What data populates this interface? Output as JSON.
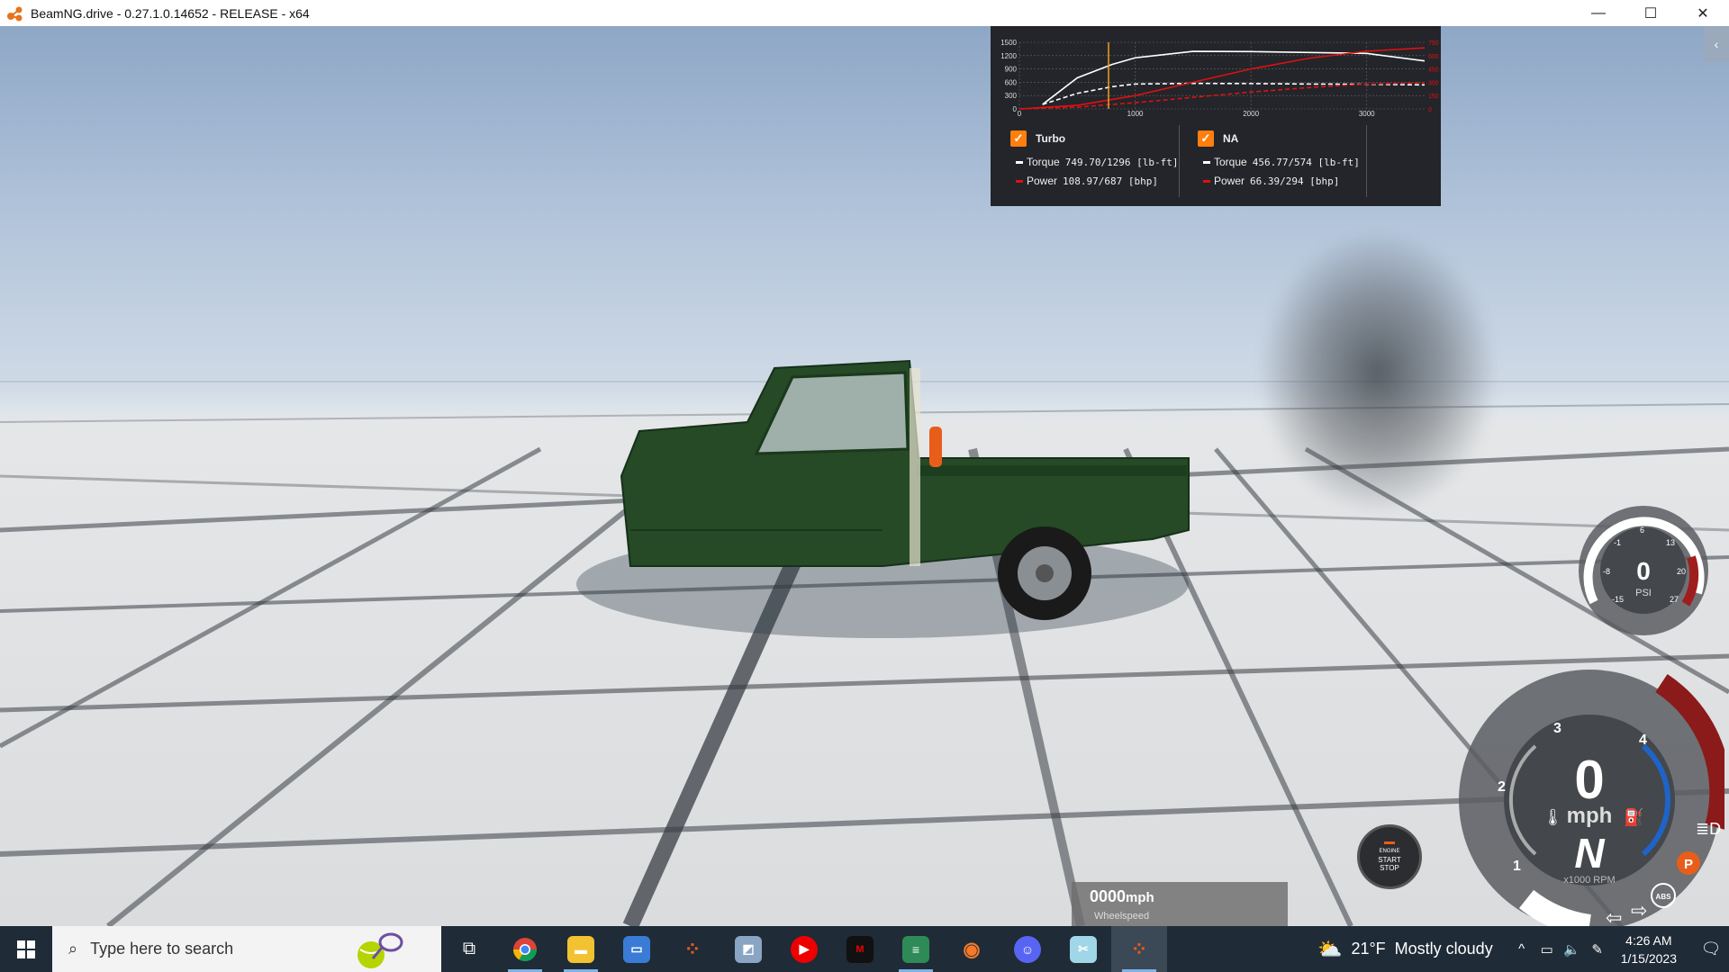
{
  "window": {
    "title": "BeamNG.drive - 0.27.1.0.14652 - RELEASE - x64",
    "minimize": "—",
    "maximize": "☐",
    "close": "✕"
  },
  "power_graph": {
    "y_ticks_left": [
      "1500",
      "1200",
      "900",
      "600",
      "300",
      "0"
    ],
    "y_ticks_right": [
      "750",
      "600",
      "450",
      "300",
      "150",
      "0"
    ],
    "x_ticks": [
      "0",
      "1000",
      "2000",
      "3000"
    ],
    "turbo": {
      "name": "Turbo",
      "checked": true,
      "torque_label": "Torque",
      "torque_value": "749.70/1296 [lb-ft]",
      "power_label": "Power",
      "power_value": "108.97/687  [bhp]"
    },
    "na": {
      "name": "NA",
      "checked": true,
      "torque_label": "Torque",
      "torque_value": "456.77/574 [lb-ft]",
      "power_label": "Power",
      "power_value": "66.39/294  [bhp]"
    },
    "colors": {
      "torque": "#ffffff",
      "power": "#e01010",
      "cursor": "#f0a020",
      "checkbox": "#ff7f0e"
    }
  },
  "chart_data": {
    "type": "line",
    "x_range": [
      0,
      3500
    ],
    "y_left_range": [
      0,
      1500
    ],
    "y_right_range": [
      0,
      750
    ],
    "series": [
      {
        "name": "Turbo Torque",
        "x": [
          200,
          500,
          800,
          1000,
          1500,
          2000,
          2500,
          3000,
          3500
        ],
        "y": [
          100,
          700,
          1000,
          1150,
          1296,
          1290,
          1270,
          1250,
          1080
        ]
      },
      {
        "name": "NA Torque",
        "x": [
          200,
          500,
          800,
          1000,
          1500,
          2000,
          2500,
          3000,
          3500
        ],
        "y": [
          100,
          350,
          500,
          560,
          574,
          570,
          560,
          555,
          540
        ]
      },
      {
        "name": "Turbo Power",
        "x": [
          0,
          500,
          1000,
          1500,
          2000,
          2500,
          3000,
          3500
        ],
        "y": [
          0,
          40,
          150,
          300,
          450,
          570,
          650,
          687
        ]
      },
      {
        "name": "NA Power",
        "x": [
          0,
          500,
          1000,
          1500,
          2000,
          2500,
          3000,
          3500
        ],
        "y": [
          0,
          20,
          70,
          130,
          190,
          240,
          280,
          294
        ]
      }
    ],
    "cursor_x": 770
  },
  "boost_gauge": {
    "value": "0",
    "unit": "PSI",
    "ticks": [
      "-15",
      "-8",
      "-1",
      "6",
      "13",
      "20",
      "27"
    ]
  },
  "speedometer": {
    "speed": "0",
    "speed_unit": "mph",
    "gear": "N",
    "rpm_label": "x1000 RPM",
    "rpm_ticks": [
      "1",
      "2",
      "3",
      "4"
    ],
    "indicators": {
      "parking": "P",
      "abs": "ABS"
    },
    "colors": {
      "redline": "#8b1a1a",
      "coolant_arc": "#1e64c8"
    }
  },
  "engine_button": {
    "line1": "ENGINE",
    "line2": "START",
    "line3": "STOP"
  },
  "wheelspeed": {
    "value": "0000",
    "unit": "mph",
    "label": "Wheelspeed"
  },
  "taskbar": {
    "search_placeholder": "Type here to search",
    "apps": [
      "task-view",
      "chrome",
      "file-explorer",
      "network-app",
      "davinci-app",
      "photos-app",
      "youtube-music",
      "mod-loader",
      "notepad-app",
      "blender",
      "discord",
      "snip-app",
      "beamng"
    ],
    "weather": {
      "temp": "21°F",
      "condition": "Mostly cloudy"
    },
    "time": "4:26 AM",
    "date": "1/15/2023"
  }
}
